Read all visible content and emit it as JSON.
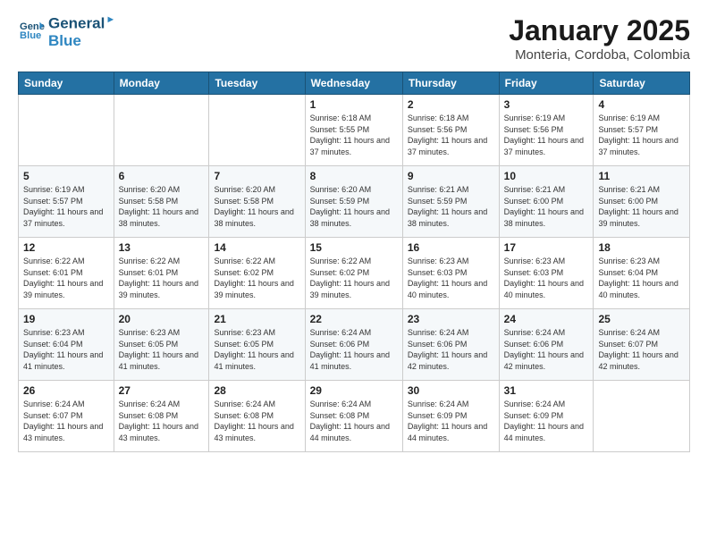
{
  "header": {
    "logo_line1": "General",
    "logo_line2": "Blue",
    "month": "January 2025",
    "location": "Monteria, Cordoba, Colombia"
  },
  "weekdays": [
    "Sunday",
    "Monday",
    "Tuesday",
    "Wednesday",
    "Thursday",
    "Friday",
    "Saturday"
  ],
  "weeks": [
    [
      {
        "day": null
      },
      {
        "day": null
      },
      {
        "day": null
      },
      {
        "day": "1",
        "sunrise": "6:18 AM",
        "sunset": "5:55 PM",
        "daylight": "11 hours and 37 minutes."
      },
      {
        "day": "2",
        "sunrise": "6:18 AM",
        "sunset": "5:56 PM",
        "daylight": "11 hours and 37 minutes."
      },
      {
        "day": "3",
        "sunrise": "6:19 AM",
        "sunset": "5:56 PM",
        "daylight": "11 hours and 37 minutes."
      },
      {
        "day": "4",
        "sunrise": "6:19 AM",
        "sunset": "5:57 PM",
        "daylight": "11 hours and 37 minutes."
      }
    ],
    [
      {
        "day": "5",
        "sunrise": "6:19 AM",
        "sunset": "5:57 PM",
        "daylight": "11 hours and 37 minutes."
      },
      {
        "day": "6",
        "sunrise": "6:20 AM",
        "sunset": "5:58 PM",
        "daylight": "11 hours and 38 minutes."
      },
      {
        "day": "7",
        "sunrise": "6:20 AM",
        "sunset": "5:58 PM",
        "daylight": "11 hours and 38 minutes."
      },
      {
        "day": "8",
        "sunrise": "6:20 AM",
        "sunset": "5:59 PM",
        "daylight": "11 hours and 38 minutes."
      },
      {
        "day": "9",
        "sunrise": "6:21 AM",
        "sunset": "5:59 PM",
        "daylight": "11 hours and 38 minutes."
      },
      {
        "day": "10",
        "sunrise": "6:21 AM",
        "sunset": "6:00 PM",
        "daylight": "11 hours and 38 minutes."
      },
      {
        "day": "11",
        "sunrise": "6:21 AM",
        "sunset": "6:00 PM",
        "daylight": "11 hours and 39 minutes."
      }
    ],
    [
      {
        "day": "12",
        "sunrise": "6:22 AM",
        "sunset": "6:01 PM",
        "daylight": "11 hours and 39 minutes."
      },
      {
        "day": "13",
        "sunrise": "6:22 AM",
        "sunset": "6:01 PM",
        "daylight": "11 hours and 39 minutes."
      },
      {
        "day": "14",
        "sunrise": "6:22 AM",
        "sunset": "6:02 PM",
        "daylight": "11 hours and 39 minutes."
      },
      {
        "day": "15",
        "sunrise": "6:22 AM",
        "sunset": "6:02 PM",
        "daylight": "11 hours and 39 minutes."
      },
      {
        "day": "16",
        "sunrise": "6:23 AM",
        "sunset": "6:03 PM",
        "daylight": "11 hours and 40 minutes."
      },
      {
        "day": "17",
        "sunrise": "6:23 AM",
        "sunset": "6:03 PM",
        "daylight": "11 hours and 40 minutes."
      },
      {
        "day": "18",
        "sunrise": "6:23 AM",
        "sunset": "6:04 PM",
        "daylight": "11 hours and 40 minutes."
      }
    ],
    [
      {
        "day": "19",
        "sunrise": "6:23 AM",
        "sunset": "6:04 PM",
        "daylight": "11 hours and 41 minutes."
      },
      {
        "day": "20",
        "sunrise": "6:23 AM",
        "sunset": "6:05 PM",
        "daylight": "11 hours and 41 minutes."
      },
      {
        "day": "21",
        "sunrise": "6:23 AM",
        "sunset": "6:05 PM",
        "daylight": "11 hours and 41 minutes."
      },
      {
        "day": "22",
        "sunrise": "6:24 AM",
        "sunset": "6:06 PM",
        "daylight": "11 hours and 41 minutes."
      },
      {
        "day": "23",
        "sunrise": "6:24 AM",
        "sunset": "6:06 PM",
        "daylight": "11 hours and 42 minutes."
      },
      {
        "day": "24",
        "sunrise": "6:24 AM",
        "sunset": "6:06 PM",
        "daylight": "11 hours and 42 minutes."
      },
      {
        "day": "25",
        "sunrise": "6:24 AM",
        "sunset": "6:07 PM",
        "daylight": "11 hours and 42 minutes."
      }
    ],
    [
      {
        "day": "26",
        "sunrise": "6:24 AM",
        "sunset": "6:07 PM",
        "daylight": "11 hours and 43 minutes."
      },
      {
        "day": "27",
        "sunrise": "6:24 AM",
        "sunset": "6:08 PM",
        "daylight": "11 hours and 43 minutes."
      },
      {
        "day": "28",
        "sunrise": "6:24 AM",
        "sunset": "6:08 PM",
        "daylight": "11 hours and 43 minutes."
      },
      {
        "day": "29",
        "sunrise": "6:24 AM",
        "sunset": "6:08 PM",
        "daylight": "11 hours and 44 minutes."
      },
      {
        "day": "30",
        "sunrise": "6:24 AM",
        "sunset": "6:09 PM",
        "daylight": "11 hours and 44 minutes."
      },
      {
        "day": "31",
        "sunrise": "6:24 AM",
        "sunset": "6:09 PM",
        "daylight": "11 hours and 44 minutes."
      },
      {
        "day": null
      }
    ]
  ],
  "labels": {
    "sunrise": "Sunrise:",
    "sunset": "Sunset:",
    "daylight": "Daylight:"
  }
}
